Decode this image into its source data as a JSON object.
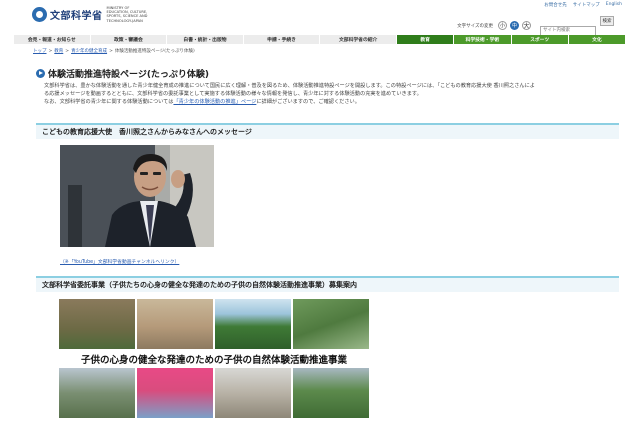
{
  "header": {
    "logo_text": "文部科学省",
    "logo_en": "MINISTRY OF EDUCATION, CULTURE, SPORTS, SCIENCE AND TECHNOLOGY-JAPAN",
    "util_links": [
      "お問合せ先",
      "サイトマップ",
      "English"
    ],
    "text_size_label": "文字サイズの変更",
    "text_size_buttons": [
      "小",
      "中",
      "大"
    ],
    "search_placeholder": "サイト内検索",
    "search_button": "検索"
  },
  "nav": {
    "left_items": [
      "会見・報道・お知らせ",
      "政策・審議会",
      "白書・統計・出版物",
      "申請・手続き",
      "文部科学省の紹介"
    ],
    "right_items": [
      "教育",
      "科学技術・学術",
      "スポーツ",
      "文化"
    ]
  },
  "breadcrumb": [
    "トップ",
    "教育",
    "青少年の健全育成",
    "体験活動推進特設ページ(たっぷり体験)"
  ],
  "page_title": "体験活動推進特設ページ(たっぷり体験)",
  "intro": {
    "line1": "文部科学省は、豊かな体験活動を通した青少年健全育成の推進について国民に広く理解・普及を図るため、体験活動推進特設ページを開設します。この特設ページには、「こどもの教育応援大使 香川照之さんによ",
    "line2": "る応援メッセージを動画するとともに、文部科学省の委託事業として実施する体験活動の様々な情報を発信し、青少年に対する体験活動の充実を進めていきます。",
    "line3_pre": "なお、文部科学省の青少年に関する体験活動については",
    "line3_link": "「青少年の体験活動の推進」ページ",
    "line3_post": "に詳細がございますので、ご確認ください。"
  },
  "section1_heading": "こどもの教育応援大使　香川照之さんからみなさんへのメッセージ",
  "video_link": "（※「YouTube」文部科学省動画チャンネルへリンク）",
  "section2_heading": "文部科学省委託事業（子供たちの心身の健全な発達のための子供の自然体験活動推進事業）募集案内",
  "banner_text": "子供の心身の健全な発達のための子供の自然体験活動推進事業",
  "colors": {
    "brand_blue": "#2b6cb0",
    "nav_green": "#4c9a2a",
    "section_border": "#8ccfe2",
    "link": "#2a5db0"
  }
}
